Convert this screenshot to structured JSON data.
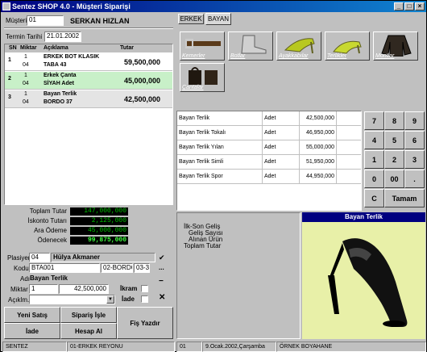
{
  "window": {
    "title": "Sentez SHOP  4.0  - Müşteri Siparişi"
  },
  "customer": {
    "label": "Müşteri",
    "code": "01",
    "name": "SERKAN  HIZLAN"
  },
  "date": {
    "label": "Termin Tarihi",
    "value": "21.01.2002"
  },
  "grid": {
    "headers": {
      "sn": "SN",
      "qty": "Miktar",
      "desc": "Açıklama",
      "amount": "Tutar"
    },
    "rows": [
      {
        "sn": "1",
        "qty": "1",
        "unit": "04",
        "desc1": "ERKEK BOT KLASIK",
        "desc2": "TABA 43",
        "amount": "59,500,000"
      },
      {
        "sn": "2",
        "qty": "1",
        "unit": "04",
        "desc1": "Erkek Çanta",
        "desc2": "SİYAH Adet",
        "amount": "45,000,000"
      },
      {
        "sn": "3",
        "qty": "1",
        "unit": "04",
        "desc1": "Bayan Terlik",
        "desc2": "BORDO 37",
        "amount": "42,500,000"
      }
    ]
  },
  "totals": {
    "total_label": "Toplam Tutar",
    "total": "147,000,000",
    "discount_label": "İskonto Tutarı",
    "discount": "2,125,000",
    "interim_label": "Ara Ödeme",
    "interim": "45,000,000",
    "payable_label": "Ödenecek",
    "payable": "99,875,000"
  },
  "form": {
    "seller_label": "Plasiyer",
    "seller_code": "04",
    "seller_name": "Hülya Akmaner",
    "code_label": "Kodu",
    "code": "BTA001",
    "variant": "02-BORDO",
    "size": "03-3",
    "name_label": "Adı",
    "name": "Bayan Terlik",
    "qty_label": "Miktar",
    "qty": "1",
    "price": "42,500,000",
    "gift_label": "İkram",
    "return_label": "İade",
    "note_label": "Açıklm."
  },
  "buttons": {
    "new_sale": "Yeni Satış",
    "process_order": "Sipariş İşle",
    "return": "İade",
    "get_account": "Hesap Al",
    "print_receipt": "Fiş Yazdır"
  },
  "tabs": [
    "ERKEK",
    "BAYAN"
  ],
  "categories": [
    "Kemerler",
    "Botlar",
    "Ayakkabılar",
    "Terlikler",
    "Montlar",
    "Çantalar"
  ],
  "products": [
    {
      "name": "Bayan Terlik",
      "unit": "Adet",
      "price": "42,500,000"
    },
    {
      "name": "Bayan Terlik Tokalı",
      "unit": "Adet",
      "price": "46,950,000"
    },
    {
      "name": "Bayan Terlik Yılan",
      "unit": "Adet",
      "price": "55,000,000"
    },
    {
      "name": "Bayan Terlik Simli",
      "unit": "Adet",
      "price": "51,950,000"
    },
    {
      "name": "Bayan Terlik Spor",
      "unit": "Adet",
      "price": "44,950,000"
    }
  ],
  "keypad": [
    "7",
    "8",
    "9",
    "4",
    "5",
    "6",
    "1",
    "2",
    "3",
    "0",
    "00",
    ".",
    "C",
    "Tamam"
  ],
  "info": {
    "line1": "İlk-Son Geliş",
    "line2": "Geliş Sayısı",
    "line3": "Alınan Ürün",
    "line4": "Toplam Tutar"
  },
  "preview": {
    "title": "Bayan Terlik"
  },
  "status": {
    "company": "SENTEZ",
    "dept": "01-ERKEK REYONU",
    "num": "01",
    "date": "9.Ocak.2002,Çarşamba",
    "store": "ÖRNEK BOYAHANE"
  },
  "colors": {
    "title": "#000080",
    "selected_row": "#c8f0c8",
    "green_total": "#00c000"
  }
}
